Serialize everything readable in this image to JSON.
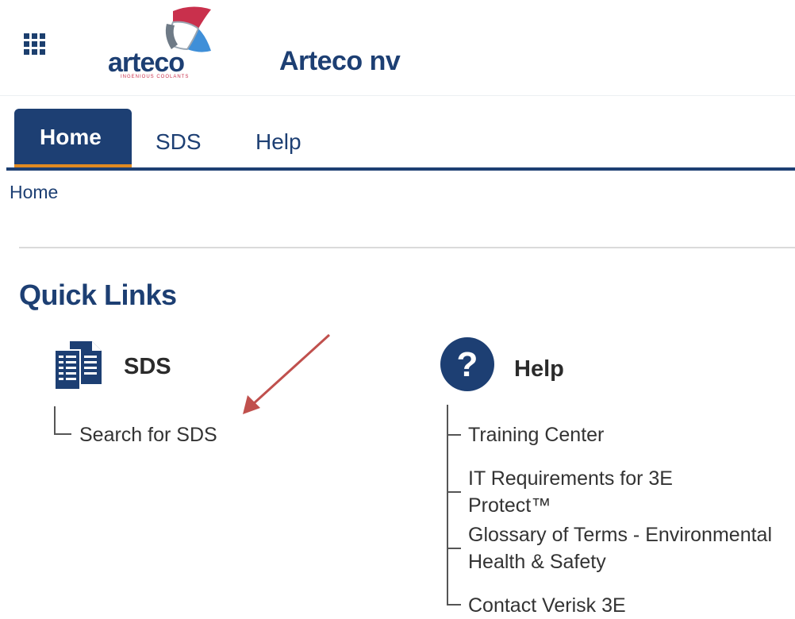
{
  "header": {
    "logo_text": "arteco",
    "logo_tagline": "INGENIOUS COOLANTS",
    "company_name": "Arteco nv",
    "app_launcher_icon": "app-grid-icon"
  },
  "nav": {
    "tabs": [
      {
        "label": "Home",
        "active": true
      },
      {
        "label": "SDS",
        "active": false
      },
      {
        "label": "Help",
        "active": false
      }
    ]
  },
  "breadcrumb": {
    "label": "Home"
  },
  "quick_links": {
    "title": "Quick Links",
    "sections": [
      {
        "title": "SDS",
        "icon": "documents-icon",
        "links": [
          "Search for SDS"
        ]
      },
      {
        "title": "Help",
        "icon": "question-circle-icon",
        "links": [
          "Training Center",
          "IT Requirements for 3E Protect™",
          "Glossary of Terms - Environmental Health & Safety",
          "Contact Verisk 3E"
        ]
      }
    ]
  },
  "colors": {
    "brand_blue": "#1d3f73",
    "accent_orange": "#e08a22",
    "annotation_arrow": "#c0504d"
  }
}
